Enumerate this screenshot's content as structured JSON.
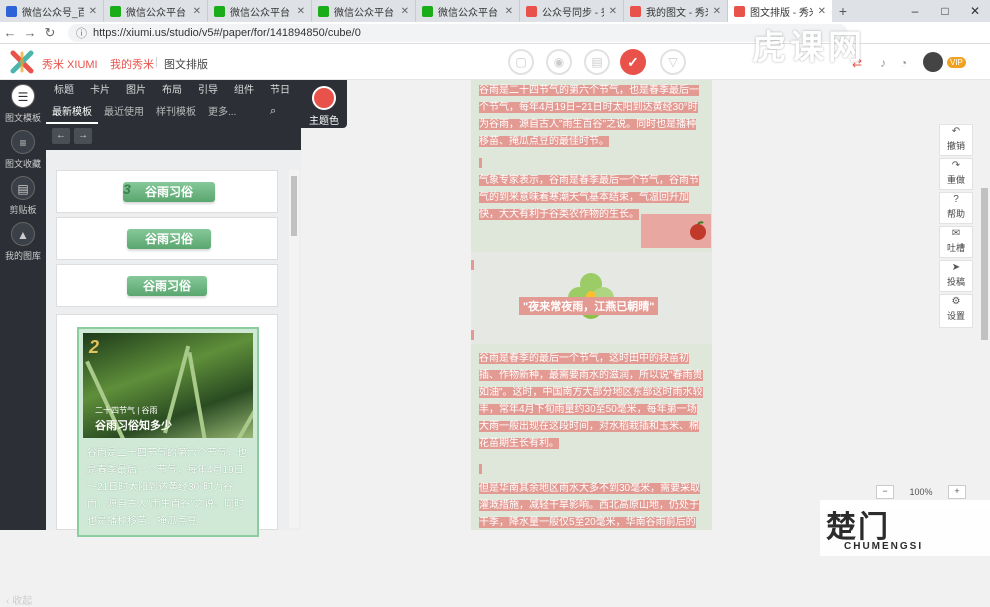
{
  "browser": {
    "tabs": [
      {
        "title": "微信公众号_百度",
        "color": "#2e63d8"
      },
      {
        "title": "微信公众平台",
        "color": "#1aad19"
      },
      {
        "title": "微信公众平台",
        "color": "#1aad19"
      },
      {
        "title": "微信公众平台",
        "color": "#1aad19"
      },
      {
        "title": "微信公众平台",
        "color": "#1aad19"
      },
      {
        "title": "公众号同步 - 秀",
        "color": "#e8524a"
      },
      {
        "title": "我的图文 - 秀米",
        "color": "#e8524a"
      },
      {
        "title": "图文排版 - 秀米",
        "color": "#e8524a"
      }
    ],
    "url": "https://xiumi.us/studio/v5#/paper/for/141894850/cube/0",
    "window_controls": [
      "–",
      "□",
      "✕"
    ]
  },
  "app": {
    "brand": "秀米 XIUMI",
    "my_link": "我的秀米",
    "breadcrumb": "图文排版",
    "save_icon": "✓"
  },
  "rail": [
    {
      "label": "图文模板",
      "icon": "☰",
      "active": true
    },
    {
      "label": "图文收藏",
      "icon": "≡"
    },
    {
      "label": "剪贴板",
      "icon": "▤"
    },
    {
      "label": "我的图库",
      "icon": "▲"
    }
  ],
  "collapse_label": "收起",
  "panel": {
    "categories": [
      "标题",
      "卡片",
      "图片",
      "布局",
      "引导",
      "组件",
      "节日"
    ],
    "subtabs": [
      "最新模板",
      "最近使用",
      "样刊模板",
      "更多..."
    ],
    "theme_label": "主题色",
    "templates": [
      {
        "ribbon": "谷雨习俗",
        "num": "3"
      },
      {
        "ribbon": "谷雨习俗"
      },
      {
        "ribbon": "谷雨习俗"
      }
    ],
    "featured": {
      "num": "2",
      "subtitle": "二十四节气 | 谷雨",
      "title": "谷雨习俗知多少",
      "text": "谷雨是二十四节气的第六个节气，也是春季最后一个节气，每年4月19日～21日时太阳到达黄经30°时为谷雨，源自古人\"雨生百谷\"之说。同时也是播种移苗、掩瓜点豆"
    }
  },
  "article": {
    "p1": "谷雨是二十四节气的第六个节气，也是春季最后一个节气，每年4月19日~21日时太阳到达黄经30°时为谷雨，源自古人\"雨生百谷\"之说。同时也是播种移苗、掩瓜点豆的最佳时节。",
    "p2": "气象专家表示，谷雨是春季最后一个节气，谷雨节气的到来意味着寒潮天气基本结束，气温回升加快，大大有利于谷类农作物的生长。",
    "quote": "\"夜来常夜雨，江燕已朝晴\"",
    "p3": "谷雨是春季的最后一个节气，这时田中的秧苗初插、作物新种，最需要雨水的滋润，所以说\"春雨贵如油\"。这时，中国南方大部分地区东部这时雨水较丰，常年4月下旬雨量约30至50毫米，每年第一场大雨一般出现在这段时间，对水稻栽插和玉米、棉花苗期生长有利。",
    "p4": "但是华南其余地区雨水大多不到30毫米，需要采取灌溉措施，减轻干旱影响。西北高原山地，仍处于干季，降水量一般仅5至20毫米，华南谷雨前后的"
  },
  "right_panel": [
    {
      "label": "撤销",
      "icon": "↶"
    },
    {
      "label": "重做",
      "icon": "↷"
    },
    {
      "label": "帮助",
      "icon": "?"
    },
    {
      "label": "吐槽",
      "icon": "✉"
    },
    {
      "label": "投稿",
      "icon": "➤"
    },
    {
      "label": "设置",
      "icon": "⚙"
    }
  ],
  "zoom": {
    "minus": "−",
    "level": "100%",
    "plus": "+"
  },
  "watermark": {
    "top": "虎课网",
    "logo": "楚门",
    "sub": "CHUMENGSI"
  },
  "colors": {
    "accent": "#e8524a",
    "dark": "#2c2f36",
    "green": "#6cb87f"
  }
}
